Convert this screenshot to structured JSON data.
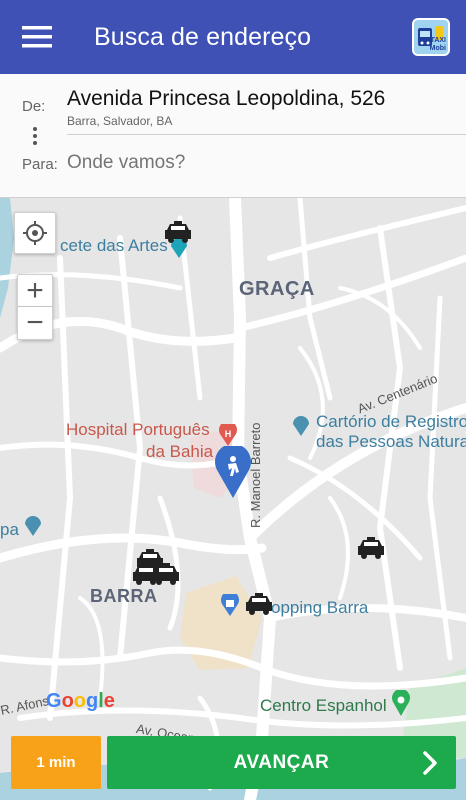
{
  "header": {
    "title": "Busca de endereço",
    "menu_icon": "hamburger-menu-icon",
    "logo_text": "TAXI Mobi",
    "background": "#3f51b5"
  },
  "address": {
    "from_label": "De:",
    "to_label": "Para:",
    "origin_main": "Avenida Princesa Leopoldina, 526",
    "origin_sub": "Barra, Salvador, BA",
    "destination_value": "",
    "destination_placeholder": "Onde vamos?"
  },
  "map": {
    "areas": [
      "GRAÇA",
      "BARRA"
    ],
    "pois": {
      "arts": "cete das Artes",
      "hospital_line1": "Hospital Português",
      "hospital_line2": "da Bahia",
      "registry_line1": "Cartório de Registro",
      "registry_line2": "das Pessoas Natura",
      "shopping": "opping Barra",
      "spanish_center": "Centro Espanhol",
      "left_edge": "pa"
    },
    "streets": {
      "manoel_barreto": "R. Manoel Barreto",
      "centenario": "Av. Centenário",
      "afonso": "R. Afons",
      "oceano": "Av. Ocean"
    },
    "zoom_in_label": "+",
    "zoom_out_label": "−",
    "google_brand": "Google"
  },
  "footer": {
    "eta_label": "1 min",
    "advance_label": "AVANÇAR",
    "eta_color": "#f8a21a",
    "advance_color": "#1caa4c"
  }
}
